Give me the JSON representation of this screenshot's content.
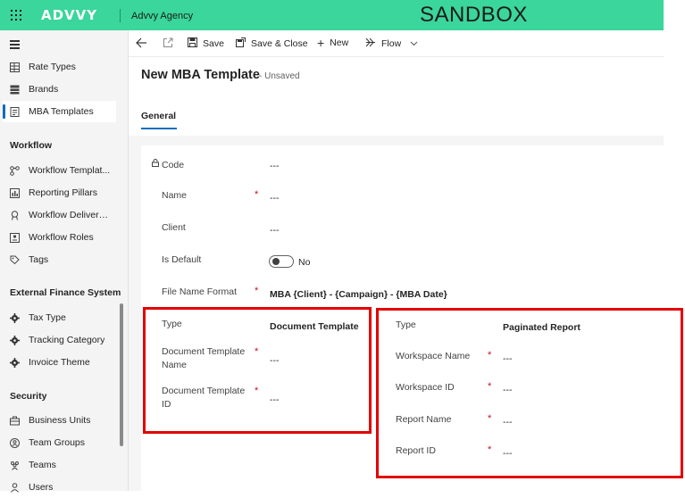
{
  "topbar": {
    "logo": "ADVVY",
    "app_name": "Advvy Agency",
    "env_label": "SANDBOX"
  },
  "sidebar": {
    "items_top": [
      {
        "label": "Rate Types",
        "icon": "table-icon"
      },
      {
        "label": "Brands",
        "icon": "stack-icon"
      },
      {
        "label": "MBA Templates",
        "icon": "document-icon",
        "active": true
      }
    ],
    "workflow_header": "Workflow",
    "workflow_items": [
      {
        "label": "Workflow Templat...",
        "icon": "flow-icon"
      },
      {
        "label": "Reporting Pillars",
        "icon": "chart-icon"
      },
      {
        "label": "Workflow Delivera...",
        "icon": "ribbon-icon"
      },
      {
        "label": "Workflow Roles",
        "icon": "roles-icon"
      },
      {
        "label": "Tags",
        "icon": "tag-icon"
      }
    ],
    "finance_header": "External Finance System",
    "finance_items": [
      {
        "label": "Tax Type",
        "icon": "gear-icon"
      },
      {
        "label": "Tracking Category",
        "icon": "gear-icon"
      },
      {
        "label": "Invoice Theme",
        "icon": "gear-icon"
      }
    ],
    "security_header": "Security",
    "security_items": [
      {
        "label": "Business Units",
        "icon": "briefcase-icon"
      },
      {
        "label": "Team Groups",
        "icon": "team-group-icon"
      },
      {
        "label": "Teams",
        "icon": "teams-icon"
      },
      {
        "label": "Users",
        "icon": "user-icon"
      }
    ]
  },
  "commandbar": {
    "save": "Save",
    "save_close": "Save & Close",
    "new": "New",
    "flow": "Flow"
  },
  "header": {
    "title": "New MBA Template",
    "status": "- Unsaved",
    "tab": "General"
  },
  "form": {
    "code_label": "Code",
    "code_value": "---",
    "name_label": "Name",
    "name_value": "---",
    "client_label": "Client",
    "client_value": "---",
    "default_label": "Is Default",
    "default_value": "No",
    "filename_label": "File Name Format",
    "filename_value": "MBA {Client} - {Campaign} - {MBA Date}"
  },
  "doc_template": {
    "type_label": "Type",
    "type_value": "Document Template",
    "name_label_1": "Document Template",
    "name_label_2": "Name",
    "name_value": "---",
    "id_label_1": "Document Template",
    "id_label_2": "ID",
    "id_value": "---"
  },
  "paginated": {
    "type_label": "Type",
    "type_value": "Paginated Report",
    "workspace_name_label": "Workspace Name",
    "workspace_name_value": "---",
    "workspace_id_label": "Workspace ID",
    "workspace_id_value": "---",
    "report_name_label": "Report Name",
    "report_name_value": "---",
    "report_id_label": "Report ID",
    "report_id_value": "---"
  },
  "required_mark": "*",
  "colors": {
    "brand": "#3ad69b",
    "accent": "#0f6cbd",
    "required": "#c50f1f",
    "highlight": "#e30000"
  }
}
